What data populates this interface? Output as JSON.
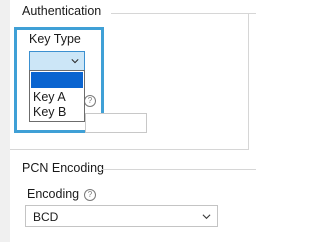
{
  "authentication": {
    "title": "Authentication",
    "key_type": {
      "label": "Key Type",
      "options": [
        "Key A",
        "Key B"
      ]
    }
  },
  "pcn_encoding": {
    "title": "PCN Encoding",
    "encoding": {
      "label": "Encoding",
      "value": "BCD"
    }
  },
  "icons": {
    "help": "help-icon",
    "dropdown": "chevron-down-icon"
  },
  "colors": {
    "highlight": "#3fa0d6",
    "selection": "#0a64d0",
    "combo_open_bg": "#cce6f7"
  }
}
